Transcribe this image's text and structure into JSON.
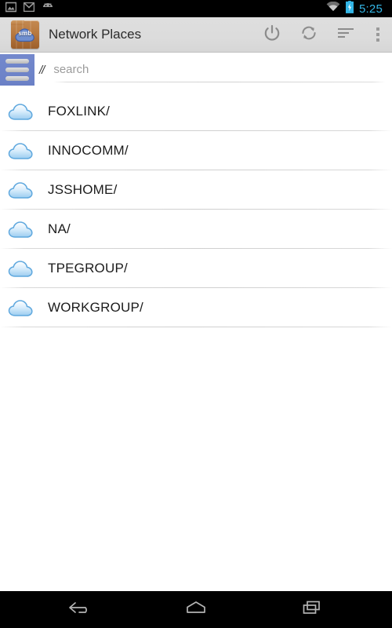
{
  "status_bar": {
    "icons": [
      "gallery-icon",
      "email-icon",
      "android-robot-icon"
    ],
    "wifi_icon": "wifi-icon",
    "battery_icon": "battery-charging-icon",
    "time": "5:25",
    "time_color": "#33b5e5",
    "background": "#000000"
  },
  "action_bar": {
    "app_icon": "smb-folder-icon",
    "app_icon_badge_text": "smb",
    "title": "Network Places",
    "background": "#dcdcdc",
    "actions": [
      {
        "name": "power-button",
        "icon": "power-icon"
      },
      {
        "name": "refresh-button",
        "icon": "refresh-icon"
      },
      {
        "name": "sort-button",
        "icon": "sort-lines-icon"
      },
      {
        "name": "overflow-menu-button",
        "icon": "overflow-dots-icon"
      }
    ]
  },
  "path_row": {
    "menu_button_icon": "hamburger-menu-icon",
    "menu_button_color": "#6a80c6",
    "path_separator": "//",
    "search_placeholder": "search",
    "search_value": ""
  },
  "list": {
    "items": [
      {
        "label": "FOXLINK/",
        "icon": "cloud-icon"
      },
      {
        "label": "INNOCOMM/",
        "icon": "cloud-icon"
      },
      {
        "label": "JSSHOME/",
        "icon": "cloud-icon"
      },
      {
        "label": "NA/",
        "icon": "cloud-icon"
      },
      {
        "label": "TPEGROUP/",
        "icon": "cloud-icon"
      },
      {
        "label": "WORKGROUP/",
        "icon": "cloud-icon"
      }
    ]
  },
  "nav_bar": {
    "background": "#000000",
    "buttons": [
      {
        "name": "back-button",
        "icon": "back-arrow-icon"
      },
      {
        "name": "home-button",
        "icon": "home-icon"
      },
      {
        "name": "recents-button",
        "icon": "recents-icon"
      }
    ]
  }
}
